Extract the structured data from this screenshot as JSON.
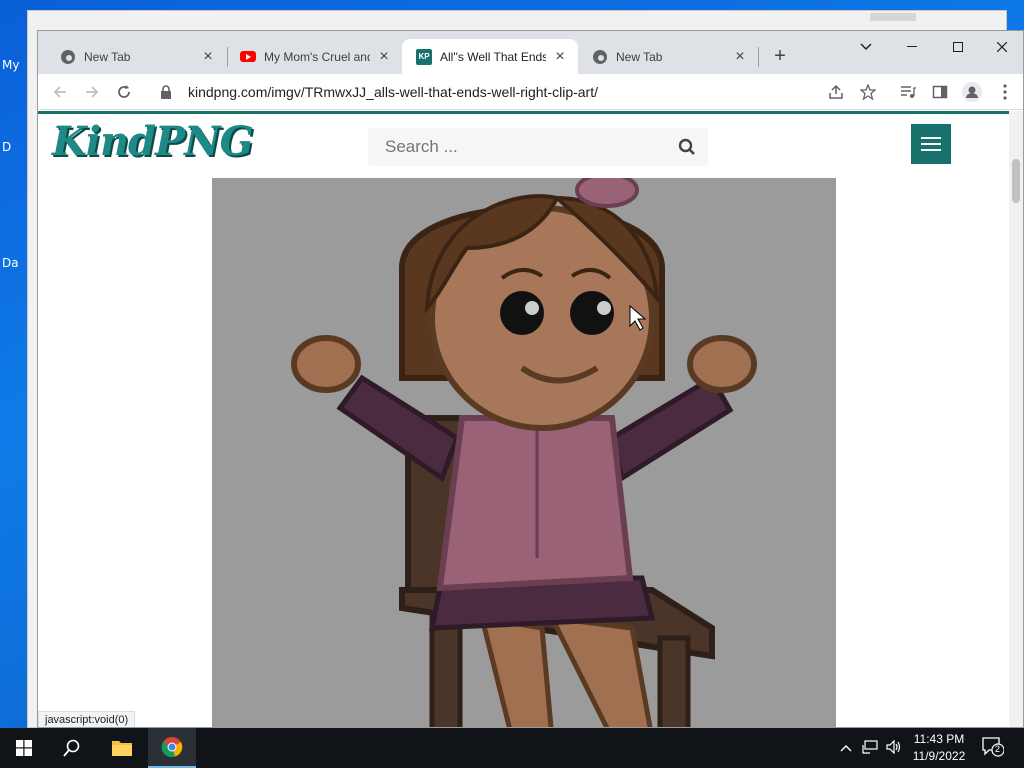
{
  "desktop": {
    "labels": [
      "My",
      "D",
      "Da"
    ]
  },
  "browser": {
    "tabs": [
      {
        "title": "New Tab",
        "icon": "chrome-icon"
      },
      {
        "title": "My Mom's Cruel and",
        "icon": "youtube-icon"
      },
      {
        "title": "All''s Well That Ends W",
        "icon": "kindpng-icon"
      },
      {
        "title": "New Tab",
        "icon": "chrome-icon"
      }
    ],
    "active_tab_index": 2,
    "url": "kindpng.com/imgv/TRmwxJJ_alls-well-that-ends-well-right-clip-art/",
    "status_text": "javascript:void(0)"
  },
  "site": {
    "logo": "KindPNG",
    "search_placeholder": "Search ...",
    "brand_color": "#17716c"
  },
  "taskbar": {
    "time": "11:43 PM",
    "date": "11/9/2022",
    "notification_count": "2"
  }
}
